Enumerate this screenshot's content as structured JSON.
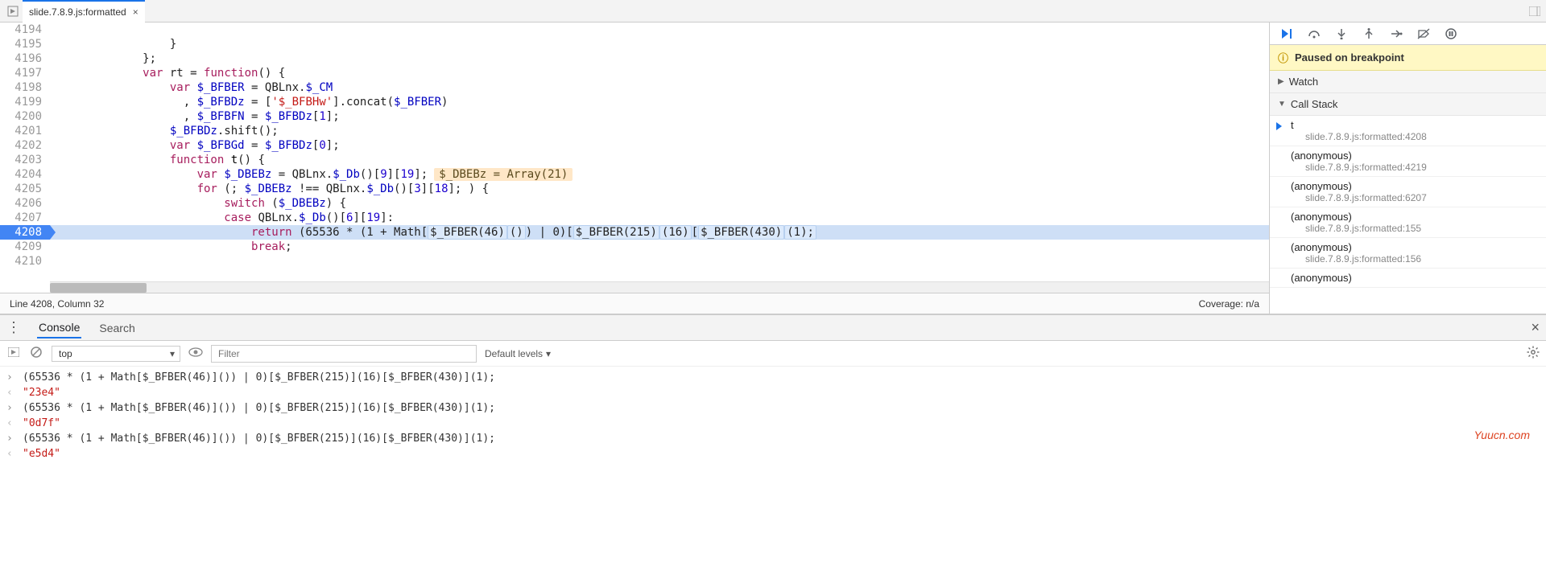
{
  "tab": {
    "title": "slide.7.8.9.js:formatted"
  },
  "status": {
    "cursor": "Line 4208, Column 32",
    "coverage": "Coverage: n/a"
  },
  "watermark": "Yuucn.com",
  "code": {
    "lines": [
      {
        "n": "4194",
        "indent": 24,
        "tokens": []
      },
      {
        "n": "4195",
        "indent": 16,
        "tokens": [
          [
            "plain",
            "}"
          ]
        ]
      },
      {
        "n": "4196",
        "indent": 12,
        "tokens": [
          [
            "plain",
            "};"
          ]
        ]
      },
      {
        "n": "4197",
        "indent": 12,
        "tokens": [
          [
            "kw",
            "var"
          ],
          [
            "plain",
            " rt = "
          ],
          [
            "kw",
            "function"
          ],
          [
            "plain",
            "() {"
          ]
        ]
      },
      {
        "n": "4198",
        "indent": 16,
        "tokens": [
          [
            "kw",
            "var"
          ],
          [
            "plain",
            " "
          ],
          [
            "var",
            "$_BFBER"
          ],
          [
            "plain",
            " = QBLnx."
          ],
          [
            "var",
            "$_CM"
          ]
        ]
      },
      {
        "n": "4199",
        "indent": 18,
        "tokens": [
          [
            "plain",
            ", "
          ],
          [
            "var",
            "$_BFBDz"
          ],
          [
            "plain",
            " = ["
          ],
          [
            "str",
            "'$_BFBHw'"
          ],
          [
            "plain",
            "].concat("
          ],
          [
            "var",
            "$_BFBER"
          ],
          [
            "plain",
            ")"
          ]
        ]
      },
      {
        "n": "4200",
        "indent": 18,
        "tokens": [
          [
            "plain",
            ", "
          ],
          [
            "var",
            "$_BFBFN"
          ],
          [
            "plain",
            " = "
          ],
          [
            "var",
            "$_BFBDz"
          ],
          [
            "plain",
            "["
          ],
          [
            "num",
            "1"
          ],
          [
            "plain",
            "];"
          ]
        ]
      },
      {
        "n": "4201",
        "indent": 16,
        "tokens": [
          [
            "var",
            "$_BFBDz"
          ],
          [
            "plain",
            ".shift();"
          ]
        ]
      },
      {
        "n": "4202",
        "indent": 16,
        "tokens": [
          [
            "kw",
            "var"
          ],
          [
            "plain",
            " "
          ],
          [
            "var",
            "$_BFBGd"
          ],
          [
            "plain",
            " = "
          ],
          [
            "var",
            "$_BFBDz"
          ],
          [
            "plain",
            "["
          ],
          [
            "num",
            "0"
          ],
          [
            "plain",
            "];"
          ]
        ]
      },
      {
        "n": "4203",
        "indent": 16,
        "tokens": [
          [
            "kw",
            "function"
          ],
          [
            "plain",
            " "
          ],
          [
            "fn",
            "t"
          ],
          [
            "plain",
            "() {"
          ]
        ]
      },
      {
        "n": "4204",
        "indent": 20,
        "tokens": [
          [
            "kw",
            "var"
          ],
          [
            "plain",
            " "
          ],
          [
            "var",
            "$_DBEBz"
          ],
          [
            "plain",
            " = QBLnx."
          ],
          [
            "var",
            "$_Db"
          ],
          [
            "plain",
            "()["
          ],
          [
            "num",
            "9"
          ],
          [
            "plain",
            "]["
          ],
          [
            "num",
            "19"
          ],
          [
            "plain",
            "];"
          ]
        ],
        "hint": "$_DBEBz = Array(21)"
      },
      {
        "n": "4205",
        "indent": 20,
        "tokens": [
          [
            "kw",
            "for"
          ],
          [
            "plain",
            " (; "
          ],
          [
            "var",
            "$_DBEBz"
          ],
          [
            "plain",
            " !== QBLnx."
          ],
          [
            "var",
            "$_Db"
          ],
          [
            "plain",
            "()["
          ],
          [
            "num",
            "3"
          ],
          [
            "plain",
            "]["
          ],
          [
            "num",
            "18"
          ],
          [
            "plain",
            "]; ) {"
          ]
        ]
      },
      {
        "n": "4206",
        "indent": 24,
        "tokens": [
          [
            "kw",
            "switch"
          ],
          [
            "plain",
            " ("
          ],
          [
            "var",
            "$_DBEBz"
          ],
          [
            "plain",
            ") {"
          ]
        ]
      },
      {
        "n": "4207",
        "indent": 24,
        "tokens": [
          [
            "kw",
            "case"
          ],
          [
            "plain",
            " QBLnx."
          ],
          [
            "var",
            "$_Db"
          ],
          [
            "plain",
            "()["
          ],
          [
            "num",
            "6"
          ],
          [
            "plain",
            "]["
          ],
          [
            "num",
            "19"
          ],
          [
            "plain",
            "]:"
          ]
        ]
      },
      {
        "n": "4208",
        "indent": 28,
        "exec": true,
        "raw": "return (65536 * (1 + Math[⟦$_BFBER(46)⟧⟦()⟧) | 0)[⟦$_BFBER(215)⟧⟦(16)⟧[⟦$_BFBER(430)⟧⟦(1);⟧"
      },
      {
        "n": "4209",
        "indent": 28,
        "tokens": [
          [
            "kw",
            "break"
          ],
          [
            "plain",
            ";"
          ]
        ]
      },
      {
        "n": "4210",
        "indent": 0,
        "tokens": []
      }
    ]
  },
  "debugger": {
    "paused": "Paused on breakpoint",
    "watch": "Watch",
    "callstack_label": "Call Stack",
    "frames": [
      {
        "fn": "t",
        "loc": "slide.7.8.9.js:formatted:4208",
        "active": true
      },
      {
        "fn": "(anonymous)",
        "loc": "slide.7.8.9.js:formatted:4219"
      },
      {
        "fn": "(anonymous)",
        "loc": "slide.7.8.9.js:formatted:6207"
      },
      {
        "fn": "(anonymous)",
        "loc": "slide.7.8.9.js:formatted:155"
      },
      {
        "fn": "(anonymous)",
        "loc": "slide.7.8.9.js:formatted:156"
      },
      {
        "fn": "(anonymous)",
        "loc": ""
      }
    ]
  },
  "drawer": {
    "tabs": {
      "console": "Console",
      "search": "Search"
    },
    "context": "top",
    "filter_placeholder": "Filter",
    "levels": "Default levels",
    "console_rows": [
      {
        "kind": "in",
        "text": "(65536 * (1 + Math[$_BFBER(46)]()) | 0)[$_BFBER(215)](16)[$_BFBER(430)](1);"
      },
      {
        "kind": "out",
        "text": "\"23e4\""
      },
      {
        "kind": "in",
        "text": "(65536 * (1 + Math[$_BFBER(46)]()) | 0)[$_BFBER(215)](16)[$_BFBER(430)](1);"
      },
      {
        "kind": "out",
        "text": "\"0d7f\""
      },
      {
        "kind": "in",
        "text": "(65536 * (1 + Math[$_BFBER(46)]()) | 0)[$_BFBER(215)](16)[$_BFBER(430)](1);"
      },
      {
        "kind": "out",
        "text": "\"e5d4\""
      }
    ]
  }
}
